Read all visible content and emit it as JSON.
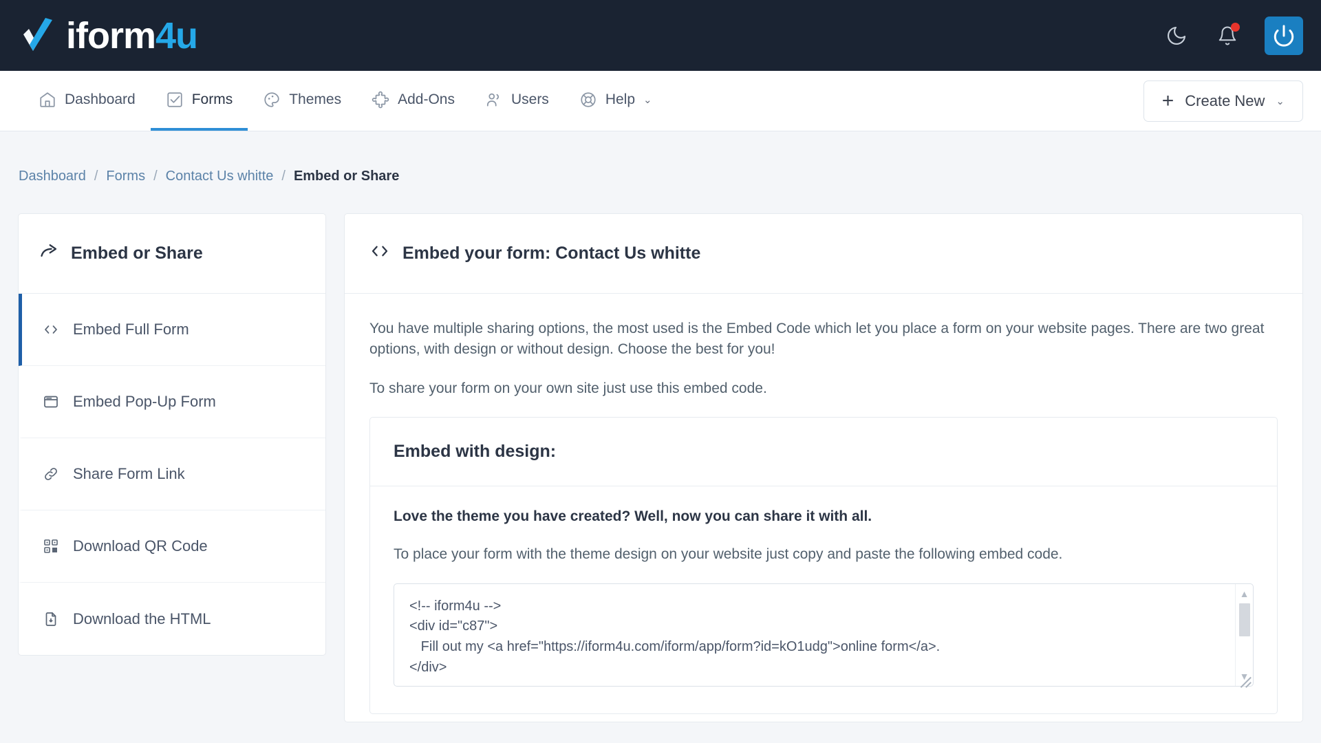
{
  "brand": {
    "name_white": "iform",
    "name_accent": "4u",
    "accent_color": "#25a8e8",
    "logo_icon": "check-logo-icon"
  },
  "topbar": {
    "dark_mode_icon": "moon-icon",
    "notifications_icon": "bell-icon",
    "has_notification_dot": true,
    "power_icon": "power-icon",
    "power_button_color": "#1a7fc1"
  },
  "nav": {
    "items": [
      {
        "label": "Dashboard",
        "icon": "home-icon",
        "active": false
      },
      {
        "label": "Forms",
        "icon": "checked-square-icon",
        "active": true
      },
      {
        "label": "Themes",
        "icon": "palette-icon",
        "active": false
      },
      {
        "label": "Add-Ons",
        "icon": "puzzle-icon",
        "active": false
      },
      {
        "label": "Users",
        "icon": "users-icon",
        "active": false
      },
      {
        "label": "Help",
        "icon": "lifebuoy-icon",
        "active": false,
        "has_caret": true
      }
    ],
    "active_underline_color": "#2f8fd6",
    "create_new": {
      "label": "Create New",
      "plus": "+",
      "caret": "⌄"
    }
  },
  "breadcrumb": {
    "items": [
      "Dashboard",
      "Forms",
      "Contact Us whitte"
    ],
    "separator": "/",
    "current": "Embed or Share"
  },
  "sidebar": {
    "header": {
      "label": "Embed or Share",
      "icon": "share-arrow-icon"
    },
    "items": [
      {
        "label": "Embed Full Form",
        "icon": "code-icon",
        "active": true
      },
      {
        "label": "Embed Pop-Up Form",
        "icon": "window-icon",
        "active": false
      },
      {
        "label": "Share Form Link",
        "icon": "link-icon",
        "active": false
      },
      {
        "label": "Download QR Code",
        "icon": "qr-code-icon",
        "active": false
      },
      {
        "label": "Download the HTML",
        "icon": "file-download-icon",
        "active": false
      }
    ],
    "active_marker_color": "#1e5fa8"
  },
  "main": {
    "header": {
      "title": "Embed your form: Contact Us whitte",
      "icon": "code-icon"
    },
    "intro_paragraph": "You have multiple sharing options, the most used is the Embed Code which let you place a form on your website pages. There are two great options, with design or without design. Choose the best for you!",
    "share_paragraph": "To share your form on your own site just use this embed code.",
    "panel": {
      "title": "Embed with design:",
      "lead": "Love the theme you have created? Well, now you can share it with all.",
      "instruction": "To place your form with the theme design on your website just copy and paste the following embed code.",
      "code": "<!-- iform4u -->\n<div id=\"c87\">\n   Fill out my <a href=\"https://iform4u.com/iform/app/form?id=kO1udg\">online form</a>.\n</div>",
      "scrollbar": {
        "up": "▲",
        "down": "▼"
      }
    }
  }
}
